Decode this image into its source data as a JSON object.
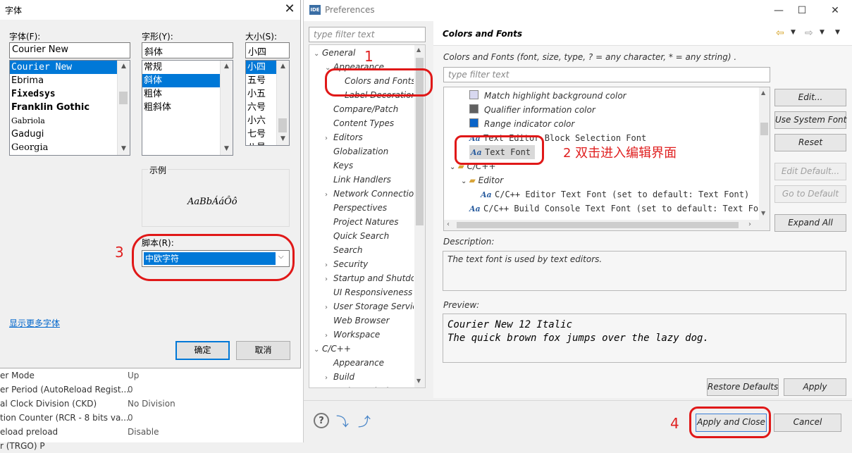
{
  "background_app": {
    "rows": [
      {
        "key": "er Mode",
        "value": "Up"
      },
      {
        "key": "er Period (AutoReload Regist...",
        "value": "0"
      },
      {
        "key": "al Clock Division (CKD)",
        "value": "No Division"
      },
      {
        "key": "tion Counter (RCR - 8 bits va...",
        "value": "0"
      },
      {
        "key": "eload preload",
        "value": "Disable"
      },
      {
        "key": "r (TRGO) P",
        "value": ""
      }
    ]
  },
  "font_dialog": {
    "title": "字体",
    "close_glyph": "✕",
    "font_label": "字体(F):",
    "font_value": "Courier New",
    "font_list": [
      "Courier New",
      "Ebrima",
      "Fixedsys",
      "Franklin Gothic",
      "Gabriola",
      "Gadugi",
      "Georgia"
    ],
    "style_label": "字形(Y):",
    "style_value": "斜体",
    "style_list": [
      "常规",
      "斜体",
      "粗体",
      "粗斜体"
    ],
    "size_label": "大小(S):",
    "size_value": "小四",
    "size_list": [
      "小四",
      "五号",
      "小五",
      "六号",
      "小六",
      "七号",
      "八号"
    ],
    "sample_label": "示例",
    "sample_text": "AaBbÁáÔô",
    "script_label": "脚本(R):",
    "script_value": "中欧字符",
    "more_fonts_link": "显示更多字体",
    "ok_label": "确定",
    "cancel_label": "取消"
  },
  "preferences": {
    "logo_text": "IDE",
    "title": "Preferences",
    "filter_placeholder": "type filter text",
    "tree": [
      {
        "label": "General",
        "level": 0,
        "twisty": "⌄"
      },
      {
        "label": "Appearance",
        "level": 1,
        "twisty": "⌄"
      },
      {
        "label": "Colors and Fonts",
        "level": 2,
        "twisty": ""
      },
      {
        "label": "Label Decorations",
        "level": 2,
        "twisty": ""
      },
      {
        "label": "Compare/Patch",
        "level": 1,
        "twisty": ""
      },
      {
        "label": "Content Types",
        "level": 1,
        "twisty": ""
      },
      {
        "label": "Editors",
        "level": 1,
        "twisty": "›"
      },
      {
        "label": "Globalization",
        "level": 1,
        "twisty": ""
      },
      {
        "label": "Keys",
        "level": 1,
        "twisty": ""
      },
      {
        "label": "Link Handlers",
        "level": 1,
        "twisty": ""
      },
      {
        "label": "Network Connections",
        "level": 1,
        "twisty": "›"
      },
      {
        "label": "Perspectives",
        "level": 1,
        "twisty": ""
      },
      {
        "label": "Project Natures",
        "level": 1,
        "twisty": ""
      },
      {
        "label": "Quick Search",
        "level": 1,
        "twisty": ""
      },
      {
        "label": "Search",
        "level": 1,
        "twisty": ""
      },
      {
        "label": "Security",
        "level": 1,
        "twisty": "›"
      },
      {
        "label": "Startup and Shutdown",
        "level": 1,
        "twisty": "›"
      },
      {
        "label": "UI Responsiveness Monitoring",
        "level": 1,
        "twisty": ""
      },
      {
        "label": "User Storage Service",
        "level": 1,
        "twisty": "›"
      },
      {
        "label": "Web Browser",
        "level": 1,
        "twisty": ""
      },
      {
        "label": "Workspace",
        "level": 1,
        "twisty": "›"
      },
      {
        "label": "C/C++",
        "level": 0,
        "twisty": "⌄"
      },
      {
        "label": "Appearance",
        "level": 1,
        "twisty": ""
      },
      {
        "label": "Build",
        "level": 1,
        "twisty": "›"
      },
      {
        "label": "Code Analysis",
        "level": 1,
        "twisty": ""
      }
    ],
    "page_title": "Colors and Fonts",
    "page_description": "Colors and Fonts (font, size, type, ? = any character, * = any string) .",
    "page_filter_placeholder": "type filter text",
    "cf_items": [
      {
        "label": "Match highlight background color",
        "kind": "color",
        "color": "#d8d8f0",
        "indent": 0
      },
      {
        "label": "Qualifier information color",
        "kind": "color",
        "color": "#606060",
        "indent": 0
      },
      {
        "label": "Range indicator color",
        "kind": "color",
        "color": "#0a64c8",
        "indent": 0
      },
      {
        "label": "Text Editor Block Selection Font",
        "kind": "font",
        "indent": 0
      },
      {
        "label": "Text Font",
        "kind": "font",
        "indent": 0,
        "selected": true
      },
      {
        "label": "C/C++",
        "kind": "folder",
        "indent": -1
      },
      {
        "label": "Editor",
        "kind": "folder",
        "indent": 0
      },
      {
        "label": "C/C++ Editor Text Font (set to default: Text Font)",
        "kind": "font",
        "indent": 1
      },
      {
        "label": "C/C++ Build Console Text Font (set to default: Text Font)",
        "kind": "font",
        "indent": 0
      }
    ],
    "buttons": {
      "edit": "Edit...",
      "use_system_font": "Use System Font",
      "reset": "Reset",
      "edit_default": "Edit Default...",
      "go_to_default": "Go to Default",
      "expand_all": "Expand All"
    },
    "description_label": "Description:",
    "description_text": "The text font is used by text editors.",
    "preview_label": "Preview:",
    "preview_lines": [
      "Courier New 12 Italic",
      "The quick brown fox jumps over the lazy dog."
    ],
    "restore_defaults": "Restore Defaults",
    "apply": "Apply",
    "apply_and_close": "Apply and Close",
    "cancel": "Cancel"
  },
  "annotations": {
    "n1": "1",
    "n2": "2 双击进入编辑界面",
    "n3": "3",
    "n4": "4"
  },
  "colors": {
    "selection_blue": "#0078d7",
    "annotation_red": "#e01818"
  }
}
